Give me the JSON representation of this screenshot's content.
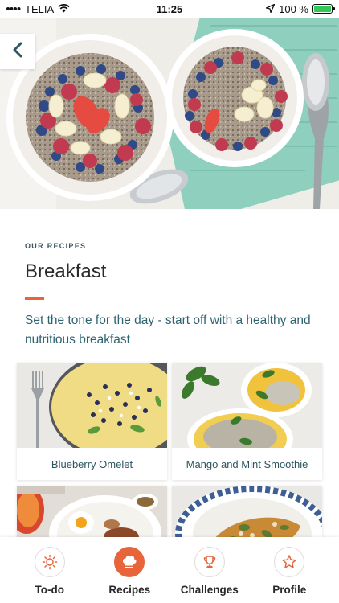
{
  "status_bar": {
    "carrier": "TELIA",
    "time": "11:25",
    "battery": "100 %",
    "battery_level": 1.0
  },
  "header": {
    "back_icon": "chevron-left-icon"
  },
  "section": {
    "kicker": "OUR RECIPES",
    "title": "Breakfast",
    "subtitle": "Set the tone for the day - start off with a healthy and nutritious breakfast"
  },
  "recipes": [
    {
      "name": "Blueberry Omelet"
    },
    {
      "name": "Mango and Mint Smoothie"
    },
    {
      "name": ""
    },
    {
      "name": ""
    }
  ],
  "tabs": [
    {
      "label": "To-do",
      "icon": "sun-icon",
      "active": false
    },
    {
      "label": "Recipes",
      "icon": "chef-hat-icon",
      "active": true
    },
    {
      "label": "Challenges",
      "icon": "trophy-icon",
      "active": false
    },
    {
      "label": "Profile",
      "icon": "star-icon",
      "active": false
    }
  ],
  "colors": {
    "accent": "#e8643a",
    "teal_text": "#2d6470",
    "battery_green": "#34c759"
  }
}
